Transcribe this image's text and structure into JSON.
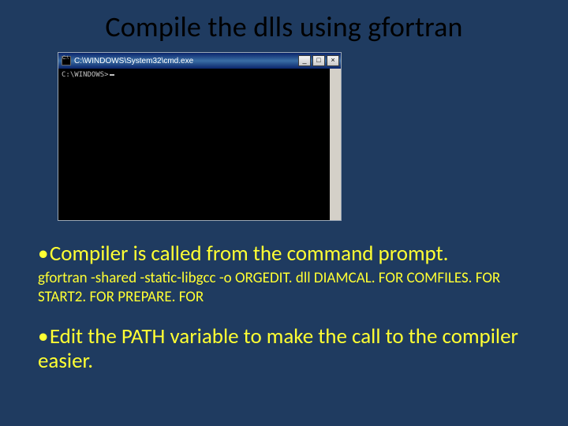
{
  "title": "Compile the dlls using gfortran",
  "cmd": {
    "titlebar": "C:\\WINDOWS\\System32\\cmd.exe",
    "prompt": "C:\\WINDOWS>",
    "min_label": "_",
    "max_label": "□",
    "close_label": "×",
    "scroll_up": "▴",
    "scroll_down": "▾"
  },
  "bullets": {
    "b1": "Compiler is called from the command prompt.",
    "cmdline": "gfortran -shared -static-libgcc -o ORGEDIT. dll DIAMCAL. FOR COMFILES. FOR START2. FOR PREPARE. FOR",
    "b2": "Edit the PATH variable to make the call to the compiler easier."
  }
}
